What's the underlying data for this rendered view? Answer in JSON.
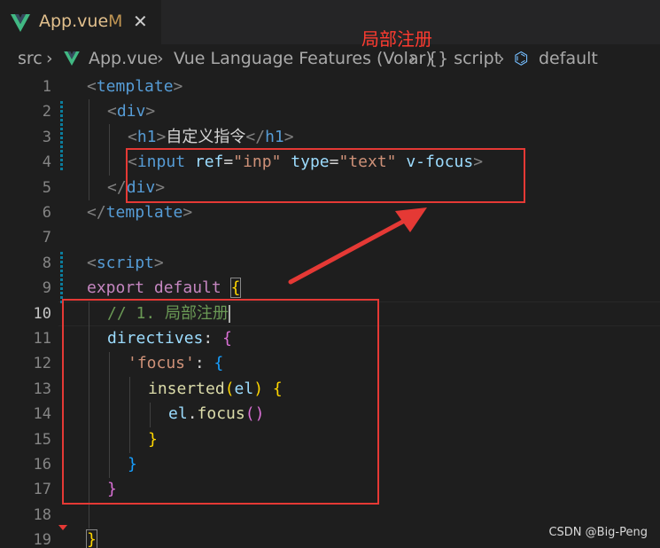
{
  "tab": {
    "title": "App.vue",
    "modified": "M",
    "close": "✕"
  },
  "breadcrumb": {
    "items": [
      "src",
      "App.vue",
      "Vue Language Features (Volar)",
      "{} script",
      "default"
    ]
  },
  "annotation": "局部注册",
  "watermark": "CSDN @Big-Peng",
  "line_numbers": [
    "1",
    "2",
    "3",
    "4",
    "5",
    "6",
    "7",
    "8",
    "9",
    "10",
    "11",
    "12",
    "13",
    "14",
    "15",
    "16",
    "17",
    "18",
    "19"
  ],
  "code": {
    "l1": [
      "<",
      "template",
      ">"
    ],
    "l2": [
      "<",
      "div",
      ">"
    ],
    "l3": [
      "<",
      "h1",
      ">",
      "自定义指令",
      "</",
      "h1",
      ">"
    ],
    "l4": [
      "<",
      "input",
      " ",
      "ref",
      "=",
      "\"inp\"",
      " ",
      "type",
      "=",
      "\"text\"",
      " ",
      "v-focus",
      ">"
    ],
    "l5": [
      "</",
      "div",
      ">"
    ],
    "l6": [
      "</",
      "template",
      ">"
    ],
    "l8": [
      "<",
      "script",
      ">"
    ],
    "l9": [
      "export",
      " ",
      "default",
      " ",
      "{"
    ],
    "l10": [
      "// 1. 局部注册"
    ],
    "l11": [
      "directives",
      ": ",
      "{"
    ],
    "l12": [
      "'focus'",
      ": ",
      "{"
    ],
    "l13": [
      "inserted",
      "(",
      "el",
      ")",
      " ",
      "{"
    ],
    "l14": [
      "el",
      ".",
      "focus",
      "(",
      ")"
    ],
    "l15": [
      "}"
    ],
    "l16": [
      "}"
    ],
    "l17": [
      "}"
    ],
    "l19": [
      "}"
    ]
  },
  "colors": {
    "highlight_box": "#e53935",
    "tab_title": "#e2c08d"
  }
}
